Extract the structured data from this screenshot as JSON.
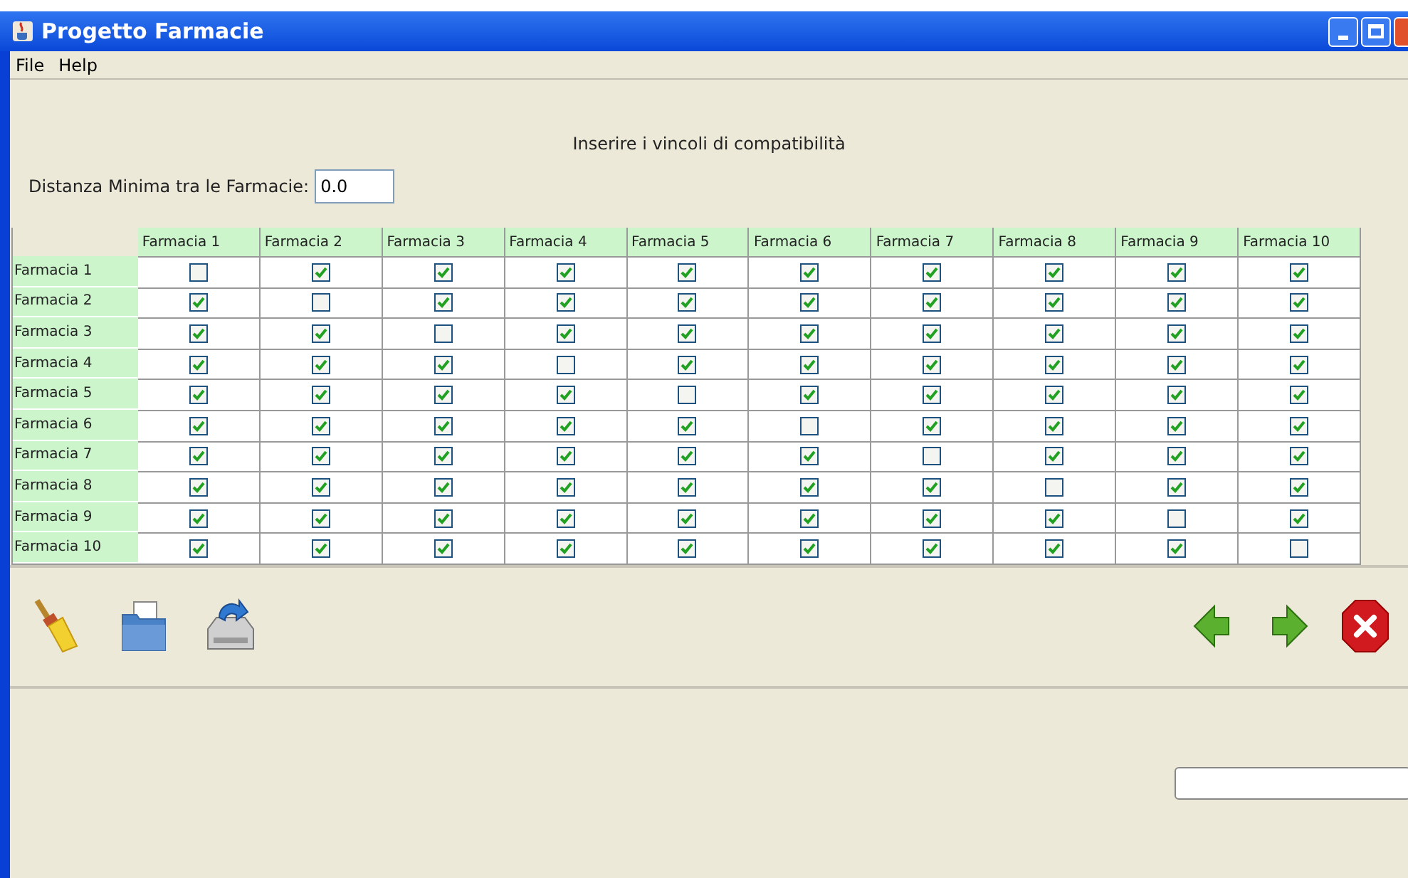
{
  "window": {
    "title": "Progetto Farmacie"
  },
  "menu": [
    "File",
    "Help"
  ],
  "heading": "Inserire i vincoli di compatibilità",
  "distance": {
    "label": "Distanza Minima tra le Farmacie:",
    "value": "0.0"
  },
  "table": {
    "columns": [
      "Farmacia 1",
      "Farmacia 2",
      "Farmacia 3",
      "Farmacia 4",
      "Farmacia 5",
      "Farmacia 6",
      "Farmacia 7",
      "Farmacia 8",
      "Farmacia 9",
      "Farmacia 10"
    ],
    "rows": [
      {
        "label": "Farmacia 1",
        "cells": [
          {
            "checked": false
          },
          {
            "checked": true
          },
          {
            "checked": true
          },
          {
            "checked": true
          },
          {
            "checked": true
          },
          {
            "checked": true
          },
          {
            "checked": true
          },
          {
            "checked": true
          },
          {
            "checked": true
          },
          {
            "checked": true
          }
        ]
      },
      {
        "label": "Farmacia 2",
        "cells": [
          {
            "checked": true
          },
          {
            "checked": false
          },
          {
            "checked": true
          },
          {
            "checked": true
          },
          {
            "checked": true
          },
          {
            "checked": true
          },
          {
            "checked": true
          },
          {
            "checked": true
          },
          {
            "checked": true
          },
          {
            "checked": true
          }
        ]
      },
      {
        "label": "Farmacia 3",
        "cells": [
          {
            "checked": true
          },
          {
            "checked": true
          },
          {
            "checked": false
          },
          {
            "checked": true
          },
          {
            "checked": true
          },
          {
            "checked": true
          },
          {
            "checked": true
          },
          {
            "checked": true
          },
          {
            "checked": true
          },
          {
            "checked": true
          }
        ]
      },
      {
        "label": "Farmacia 4",
        "cells": [
          {
            "checked": true
          },
          {
            "checked": true
          },
          {
            "checked": true
          },
          {
            "checked": false
          },
          {
            "checked": true
          },
          {
            "checked": true
          },
          {
            "checked": true
          },
          {
            "checked": true
          },
          {
            "checked": true
          },
          {
            "checked": true
          }
        ]
      },
      {
        "label": "Farmacia 5",
        "cells": [
          {
            "checked": true
          },
          {
            "checked": true
          },
          {
            "checked": true
          },
          {
            "checked": true
          },
          {
            "checked": false
          },
          {
            "checked": true
          },
          {
            "checked": true
          },
          {
            "checked": true
          },
          {
            "checked": true
          },
          {
            "checked": true
          }
        ]
      },
      {
        "label": "Farmacia 6",
        "cells": [
          {
            "checked": true
          },
          {
            "checked": true
          },
          {
            "checked": true
          },
          {
            "checked": true
          },
          {
            "checked": true
          },
          {
            "checked": false
          },
          {
            "checked": true
          },
          {
            "checked": true
          },
          {
            "checked": true
          },
          {
            "checked": true
          }
        ]
      },
      {
        "label": "Farmacia 7",
        "cells": [
          {
            "checked": true
          },
          {
            "checked": true
          },
          {
            "checked": true
          },
          {
            "checked": true
          },
          {
            "checked": true
          },
          {
            "checked": true
          },
          {
            "checked": false
          },
          {
            "checked": true
          },
          {
            "checked": true
          },
          {
            "checked": true
          }
        ]
      },
      {
        "label": "Farmacia 8",
        "cells": [
          {
            "checked": true
          },
          {
            "checked": true
          },
          {
            "checked": true
          },
          {
            "checked": true
          },
          {
            "checked": true
          },
          {
            "checked": true
          },
          {
            "checked": true
          },
          {
            "checked": false
          },
          {
            "checked": true
          },
          {
            "checked": true
          }
        ]
      },
      {
        "label": "Farmacia 9",
        "cells": [
          {
            "checked": true
          },
          {
            "checked": true
          },
          {
            "checked": true
          },
          {
            "checked": true
          },
          {
            "checked": true
          },
          {
            "checked": true
          },
          {
            "checked": true
          },
          {
            "checked": true
          },
          {
            "checked": false
          },
          {
            "checked": true
          }
        ]
      },
      {
        "label": "Farmacia 10",
        "cells": [
          {
            "checked": true
          },
          {
            "checked": true
          },
          {
            "checked": true
          },
          {
            "checked": true
          },
          {
            "checked": true
          },
          {
            "checked": true
          },
          {
            "checked": true
          },
          {
            "checked": true
          },
          {
            "checked": true
          },
          {
            "checked": false
          }
        ]
      }
    ]
  }
}
